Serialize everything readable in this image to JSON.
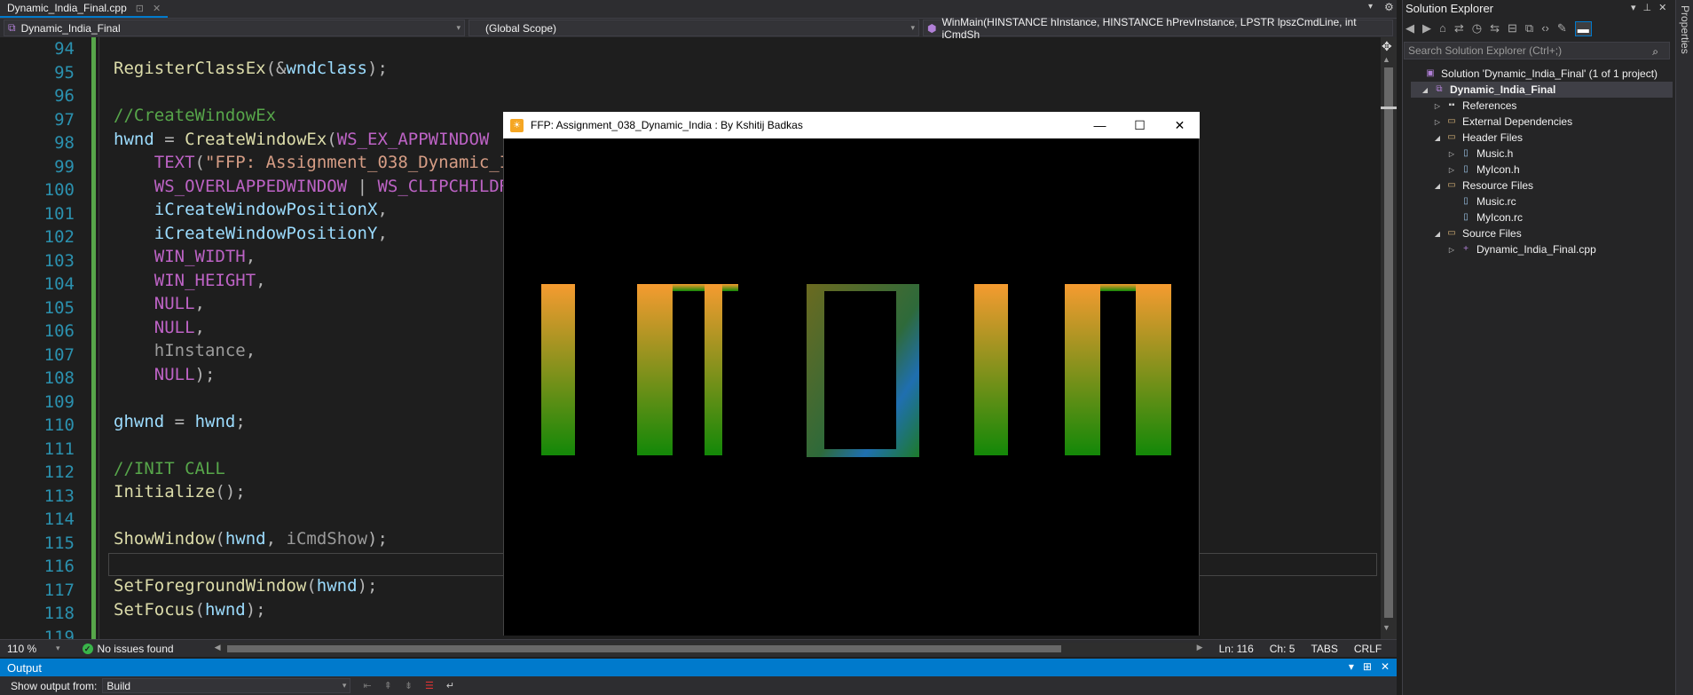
{
  "tab": {
    "filename": "Dynamic_India_Final.cpp",
    "pin": "⊡",
    "close": "✕"
  },
  "navbar": {
    "project": "Dynamic_India_Final",
    "scope": "(Global Scope)",
    "function": "WinMain(HINSTANCE hInstance, HINSTANCE hPrevInstance, LPSTR lpszCmdLine, int iCmdSh"
  },
  "editor": {
    "line_numbers": [
      "94",
      "95",
      "96",
      "97",
      "98",
      "99",
      "100",
      "101",
      "102",
      "103",
      "104",
      "105",
      "106",
      "107",
      "108",
      "109",
      "110",
      "111",
      "112",
      "113",
      "114",
      "115",
      "116",
      "117",
      "118",
      "119"
    ],
    "zoom": "110 %",
    "issues": "No issues found",
    "ln": "Ln: 116",
    "ch": "Ch: 5",
    "tabs": "TABS",
    "eol": "CRLF"
  },
  "output": {
    "title": "Output",
    "show_from_label": "Show output from:",
    "source": "Build"
  },
  "solution_explorer": {
    "title": "Solution Explorer",
    "search_placeholder": "Search Solution Explorer (Ctrl+;)",
    "solution": "Solution 'Dynamic_India_Final' (1 of 1 project)",
    "project": "Dynamic_India_Final",
    "references": "References",
    "external": "External Dependencies",
    "header_files": "Header Files",
    "music_h": "Music.h",
    "myicon_h": "MyIcon.h",
    "resource_files": "Resource Files",
    "music_rc": "Music.rc",
    "myicon_rc": "MyIcon.rc",
    "source_files": "Source Files",
    "main_cpp": "Dynamic_India_Final.cpp"
  },
  "properties_label": "Properties",
  "app_window": {
    "title": "FFP: Assignment_038_Dynamic_India : By Kshitij Badkas",
    "minimize": "—",
    "maximize": "☐",
    "close": "✕",
    "colors": {
      "saffron": "#f59b30",
      "green": "#138808",
      "blue": "#1f6fb0",
      "background": "#000000"
    }
  }
}
